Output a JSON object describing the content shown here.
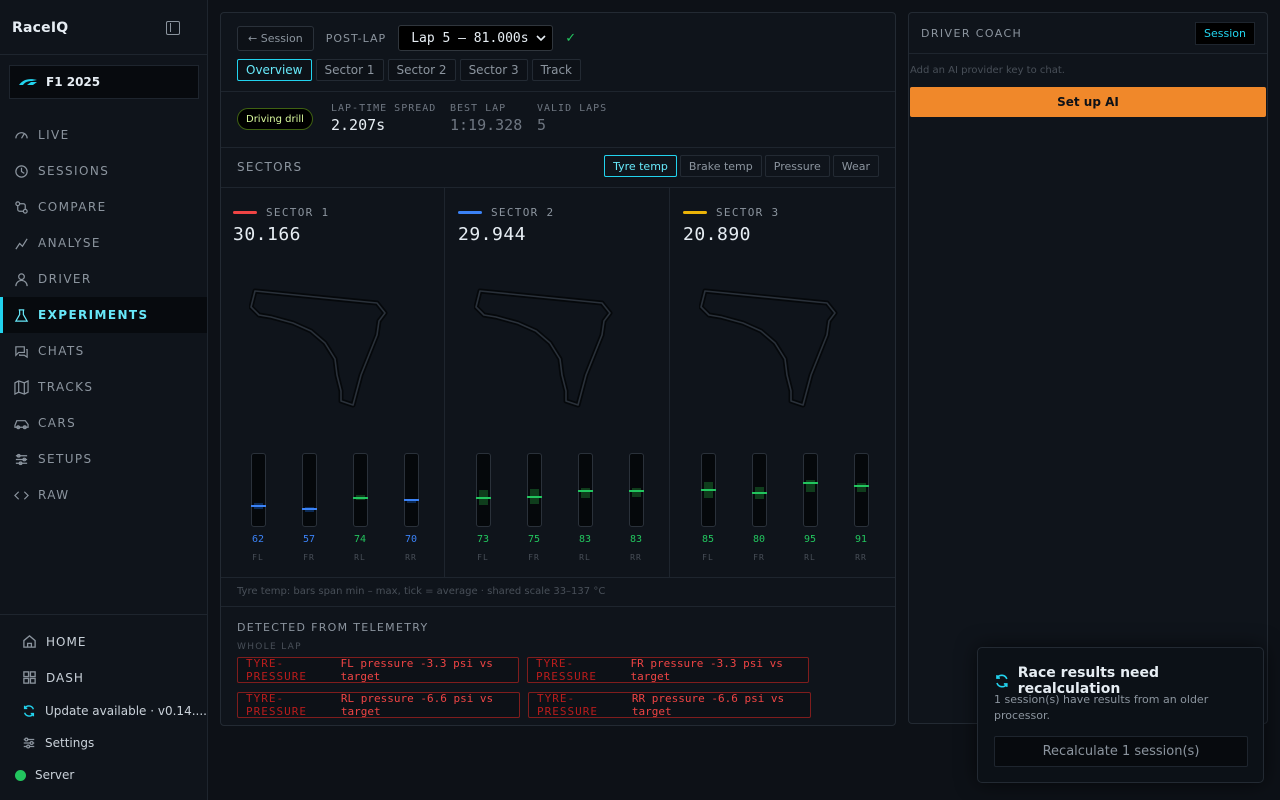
{
  "app": {
    "title": "RaceIQ"
  },
  "sidebar": {
    "game": "F1 2025",
    "items": [
      {
        "label": "LIVE",
        "icon": "gauge-icon"
      },
      {
        "label": "SESSIONS",
        "icon": "history-icon"
      },
      {
        "label": "COMPARE",
        "icon": "compare-icon"
      },
      {
        "label": "ANALYSE",
        "icon": "chart-icon"
      },
      {
        "label": "DRIVER",
        "icon": "user-icon"
      },
      {
        "label": "EXPERIMENTS",
        "icon": "flask-icon"
      },
      {
        "label": "CHATS",
        "icon": "chat-icon"
      },
      {
        "label": "TRACKS",
        "icon": "map-icon"
      },
      {
        "label": "CARS",
        "icon": "car-icon"
      },
      {
        "label": "SETUPS",
        "icon": "sliders-icon"
      },
      {
        "label": "RAW",
        "icon": "code-icon"
      }
    ],
    "active": "EXPERIMENTS",
    "bottom": {
      "home": "HOME",
      "dash": "DASH",
      "update": "Update available · v0.14....",
      "settings": "Settings",
      "server": "Server"
    }
  },
  "main": {
    "back_label": "← Session",
    "mode_label": "POST-LAP",
    "lap_select": "Lap 5 — 81.000s",
    "tabs": [
      "Overview",
      "Sector 1",
      "Sector 2",
      "Sector 3",
      "Track"
    ],
    "active_tab": "Overview",
    "drill_badge": "Driving drill",
    "stats": {
      "spread_label": "LAP-TIME SPREAD",
      "spread_value": "2.207s",
      "best_label": "BEST LAP",
      "best_value": "1:19.328",
      "valid_label": "VALID LAPS",
      "valid_value": "5"
    },
    "sectors_title": "SECTORS",
    "metric_tabs": [
      "Tyre temp",
      "Brake temp",
      "Pressure",
      "Wear"
    ],
    "active_metric": "Tyre temp",
    "sectors": [
      {
        "name": "SECTOR 1",
        "time": "30.166",
        "color": "#ef4444",
        "tyres": [
          {
            "pos": "FL",
            "avg": "62",
            "min": 58,
            "max": 66,
            "tone": "cold"
          },
          {
            "pos": "FR",
            "avg": "57",
            "min": 53,
            "max": 60,
            "tone": "cold"
          },
          {
            "pos": "RL",
            "avg": "74",
            "min": 70,
            "max": 78,
            "tone": "ok"
          },
          {
            "pos": "RR",
            "avg": "70",
            "min": 66,
            "max": 72,
            "tone": "cold"
          }
        ]
      },
      {
        "name": "SECTOR 2",
        "time": "29.944",
        "color": "#3b82f6",
        "tyres": [
          {
            "pos": "FL",
            "avg": "73",
            "min": 64,
            "max": 85,
            "tone": "ok"
          },
          {
            "pos": "FR",
            "avg": "75",
            "min": 65,
            "max": 87,
            "tone": "ok"
          },
          {
            "pos": "RL",
            "avg": "83",
            "min": 74,
            "max": 88,
            "tone": "ok"
          },
          {
            "pos": "RR",
            "avg": "83",
            "min": 75,
            "max": 88,
            "tone": "ok"
          }
        ]
      },
      {
        "name": "SECTOR 3",
        "time": "20.890",
        "color": "#eab308",
        "tyres": [
          {
            "pos": "FL",
            "avg": "85",
            "min": 74,
            "max": 96,
            "tone": "ok"
          },
          {
            "pos": "FR",
            "avg": "80",
            "min": 72,
            "max": 90,
            "tone": "ok"
          },
          {
            "pos": "RL",
            "avg": "95",
            "min": 82,
            "max": 99,
            "tone": "ok"
          },
          {
            "pos": "RR",
            "avg": "91",
            "min": 82,
            "max": 95,
            "tone": "ok"
          }
        ]
      }
    ],
    "scale": {
      "min": 33,
      "max": 137
    },
    "legend_note": "Tyre temp: bars span min – max, tick = average · shared scale 33–137 °C",
    "detected_title": "DETECTED FROM TELEMETRY",
    "whole_lap": "WHOLE LAP",
    "issues": [
      {
        "type": "TYRE-PRESSURE",
        "msg": "FL pressure -3.3 psi vs target"
      },
      {
        "type": "TYRE-PRESSURE",
        "msg": "FR pressure -3.3 psi vs target"
      },
      {
        "type": "TYRE-PRESSURE",
        "msg": "RL pressure -6.6 psi vs target"
      },
      {
        "type": "TYRE-PRESSURE",
        "msg": "RR pressure -6.6 psi vs target"
      }
    ]
  },
  "coach": {
    "title": "DRIVER COACH",
    "tag": "Session",
    "note": "Add an AI provider key to chat.",
    "button": "Set up AI"
  },
  "toast": {
    "title": "Race results need recalculation",
    "body": "1 session(s) have results from an older processor.",
    "button": "Recalculate 1 session(s)"
  },
  "colors": {
    "accent": "#22d3ee",
    "cold": "#3b82f6",
    "ok": "#22c55e",
    "warning": "#ef4444",
    "cta": "#f0882a"
  }
}
